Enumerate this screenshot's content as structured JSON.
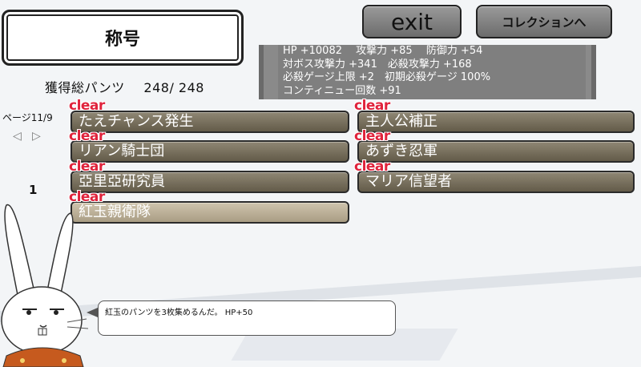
{
  "title": "称号",
  "collected": {
    "label": "獲得総パンツ",
    "value": "248/ 248"
  },
  "buttons": {
    "exit": "exit",
    "collection": "コレクションへ"
  },
  "stats": [
    "HP +10082　 攻撃力 +85　 防御力 +54",
    "対ボス攻撃力 +341　必殺攻撃力 +168",
    "必殺ゲージ上限 +2　初期必殺ゲージ 100%",
    "コンティニュー回数 +91"
  ],
  "page": {
    "label": "ページ11/9",
    "number": "1"
  },
  "clear_label": "clear",
  "items_left": [
    "たえチャンス発生",
    "リアン騎士団",
    "亞里亞研究員",
    "紅玉親衛隊"
  ],
  "items_right": [
    "主人公補正",
    "あずき忍軍",
    "マリア信望者"
  ],
  "selected": "紅玉親衛隊",
  "message": "紅玉のパンツを3枚集めるんだ。 HP+50",
  "colors": {
    "clear": "#e0233c",
    "item": "#736b58",
    "item_selected": "#bdb298"
  }
}
